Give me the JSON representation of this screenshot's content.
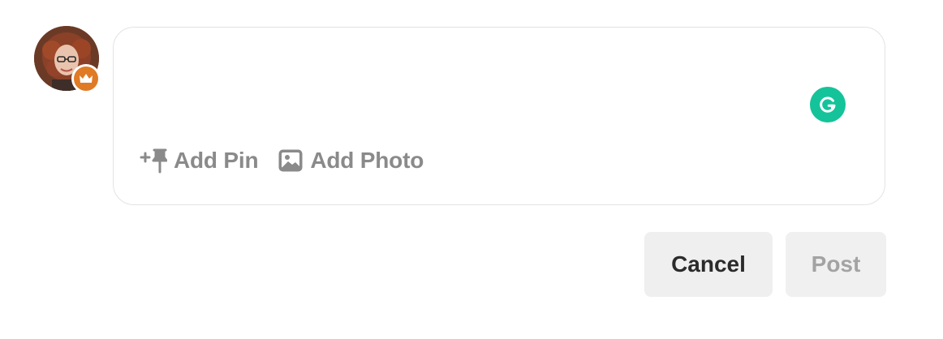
{
  "user": {
    "avatar_icon": "user-photo",
    "badge_icon": "crown-icon",
    "badge_color": "#e07a25"
  },
  "composer": {
    "input_value": "",
    "input_placeholder": "",
    "grammarly_icon": "grammarly-icon",
    "grammarly_color": "#15c39a",
    "tools": {
      "add_pin_label": "Add Pin",
      "add_pin_icon": "add-pin-icon",
      "add_photo_label": "Add Photo",
      "add_photo_icon": "image-icon"
    }
  },
  "actions": {
    "cancel_label": "Cancel",
    "post_label": "Post"
  }
}
